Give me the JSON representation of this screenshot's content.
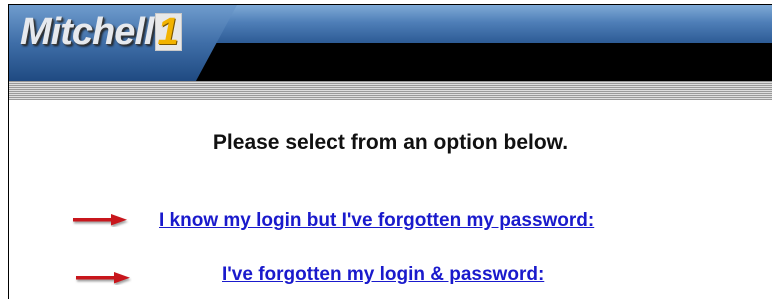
{
  "brand": {
    "logo_text": "Mitchell",
    "logo_number": "1"
  },
  "page": {
    "heading": "Please select from an option below."
  },
  "options": [
    {
      "label": "I know my login but I've forgotten my password:"
    },
    {
      "label": "I've forgotten my login & password:"
    }
  ],
  "icons": {
    "arrow": "red-arrow-right-icon"
  },
  "colors": {
    "link": "#1a1acc",
    "arrow": "#c8141a",
    "header_blue": "#3f6ea8",
    "logo_accent": "#f2b300"
  }
}
